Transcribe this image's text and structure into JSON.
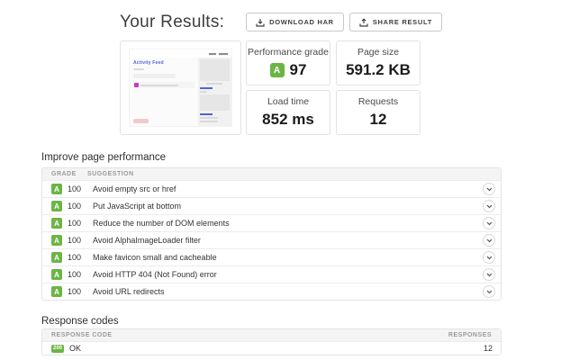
{
  "page": {
    "title": "Your Results:"
  },
  "actions": {
    "download_label": "DOWNLOAD HAR",
    "share_label": "SHARE RESULT"
  },
  "thumbnail": {
    "page_title": "Activity Feed"
  },
  "metrics": [
    {
      "label": "Performance grade",
      "grade": "A",
      "value": "97"
    },
    {
      "label": "Page size",
      "value": "591.2 KB"
    },
    {
      "label": "Load time",
      "value": "852 ms"
    },
    {
      "label": "Requests",
      "value": "12"
    }
  ],
  "improve_section": {
    "heading": "Improve page performance",
    "columns": {
      "grade": "GRADE",
      "suggestion": "SUGGESTION"
    },
    "rows": [
      {
        "grade": "A",
        "score": "100",
        "suggestion": "Avoid empty src or href"
      },
      {
        "grade": "A",
        "score": "100",
        "suggestion": "Put JavaScript at bottom"
      },
      {
        "grade": "A",
        "score": "100",
        "suggestion": "Reduce the number of DOM elements"
      },
      {
        "grade": "A",
        "score": "100",
        "suggestion": "Avoid AlphaImageLoader filter"
      },
      {
        "grade": "A",
        "score": "100",
        "suggestion": "Make favicon small and cacheable"
      },
      {
        "grade": "A",
        "score": "100",
        "suggestion": "Avoid HTTP 404 (Not Found) error"
      },
      {
        "grade": "A",
        "score": "100",
        "suggestion": "Avoid URL redirects"
      }
    ]
  },
  "response_section": {
    "heading": "Response codes",
    "columns": {
      "code": "RESPONSE CODE",
      "responses": "RESPONSES"
    },
    "rows": [
      {
        "code": "200",
        "label": "OK",
        "responses": "12"
      }
    ]
  },
  "colors": {
    "grade_green": "#6cb544",
    "status_green": "#6cb544",
    "accent_magenta": "#c73cbe"
  }
}
